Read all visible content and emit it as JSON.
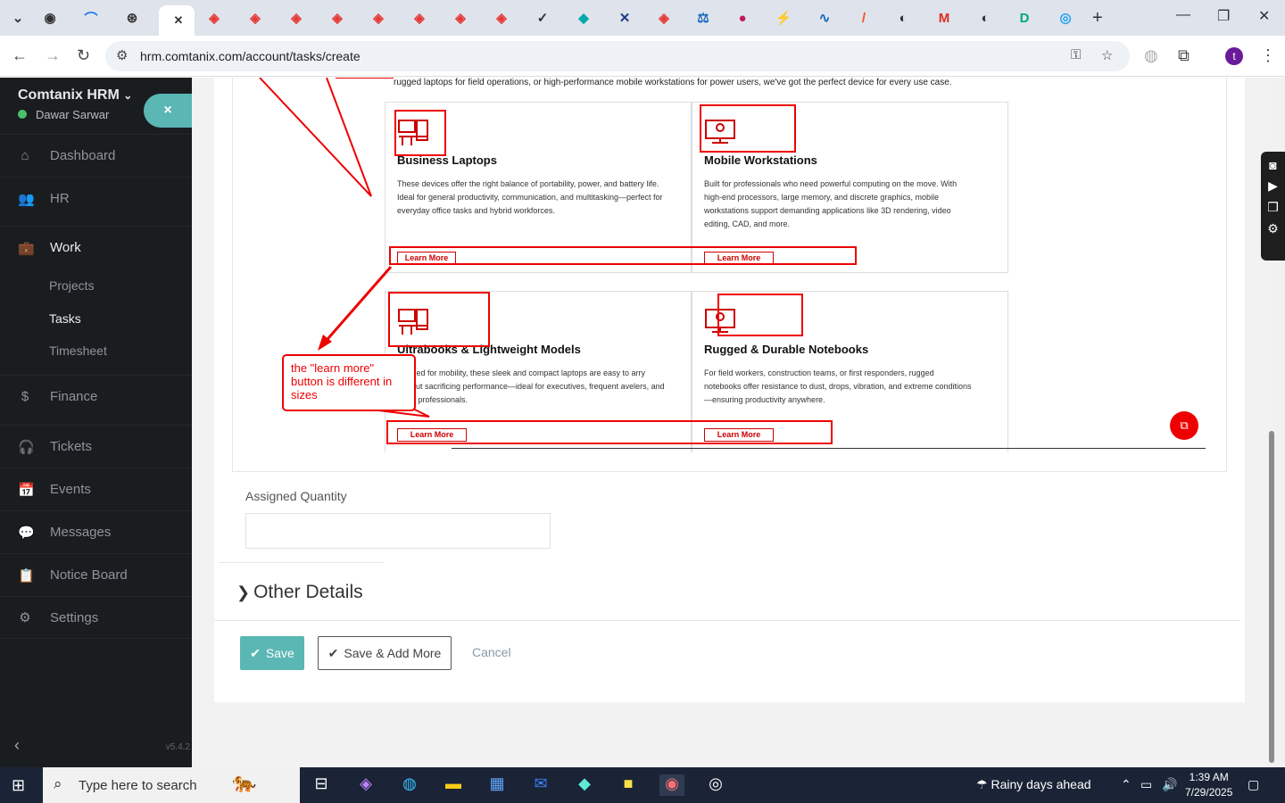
{
  "browser": {
    "url": "hrm.comtanix.com/account/tasks/create",
    "profile_initial": "t",
    "new_tab": "+"
  },
  "sidebar": {
    "brand": "Comtanix HRM",
    "user": "Dawar Sarwar",
    "close": "×",
    "items": [
      {
        "label": "Dashboard",
        "icon": "⌂"
      },
      {
        "label": "HR",
        "icon": "👥"
      },
      {
        "label": "Work",
        "icon": "💼"
      },
      {
        "label": "Finance",
        "icon": "$"
      },
      {
        "label": "Tickets",
        "icon": "🎧"
      },
      {
        "label": "Events",
        "icon": "📅"
      },
      {
        "label": "Messages",
        "icon": "💬"
      },
      {
        "label": "Notice Board",
        "icon": "📋"
      },
      {
        "label": "Settings",
        "icon": "⚙"
      }
    ],
    "sub_items": [
      "Projects",
      "Tasks",
      "Timesheet"
    ],
    "version": "v5.4.2"
  },
  "editor_image": {
    "intro": "rugged laptops for field operations, or high-performance mobile workstations for power users, we've got the perfect device for every use case.",
    "products": [
      {
        "name": "Business Laptops",
        "desc": "These devices offer the right balance of portability, power, and battery life. Ideal for general productivity, communication, and multitasking—perfect for everyday office tasks and hybrid workforces.",
        "button": "Learn More"
      },
      {
        "name": "Mobile Workstations",
        "desc": "Built for professionals who need powerful computing on the move. With high-end processors, large memory, and discrete graphics, mobile workstations support demanding applications like 3D rendering, video editing, CAD, and more.",
        "button": "Learn More"
      },
      {
        "name": "Ultrabooks & Lightweight Models",
        "desc": "esigned for mobility, these sleek and compact laptops are easy to arry without sacrificing performance—ideal for executives, frequent avelers, and sales professionals.",
        "button": "Learn More"
      },
      {
        "name": "Rugged & Durable Notebooks",
        "desc": "For field workers, construction teams, or first responders, rugged notebooks offer resistance to dust, drops, vibration, and extreme conditions—ensuring productivity anywhere.",
        "button": "Learn More"
      }
    ],
    "callout": "the \"learn more\" button is different in sizes",
    "annotation_color": "#e00000"
  },
  "form": {
    "assigned_quantity_label": "Assigned Quantity",
    "assigned_quantity_value": "",
    "other_details": "Other Details",
    "save": "Save",
    "save_add_more": "Save & Add More",
    "cancel": "Cancel",
    "accent": "#5ab7b3"
  },
  "taskbar": {
    "search_placeholder": "Type here to search",
    "weather": "Rainy days ahead",
    "time": "1:39 AM",
    "date": "7/29/2025"
  }
}
